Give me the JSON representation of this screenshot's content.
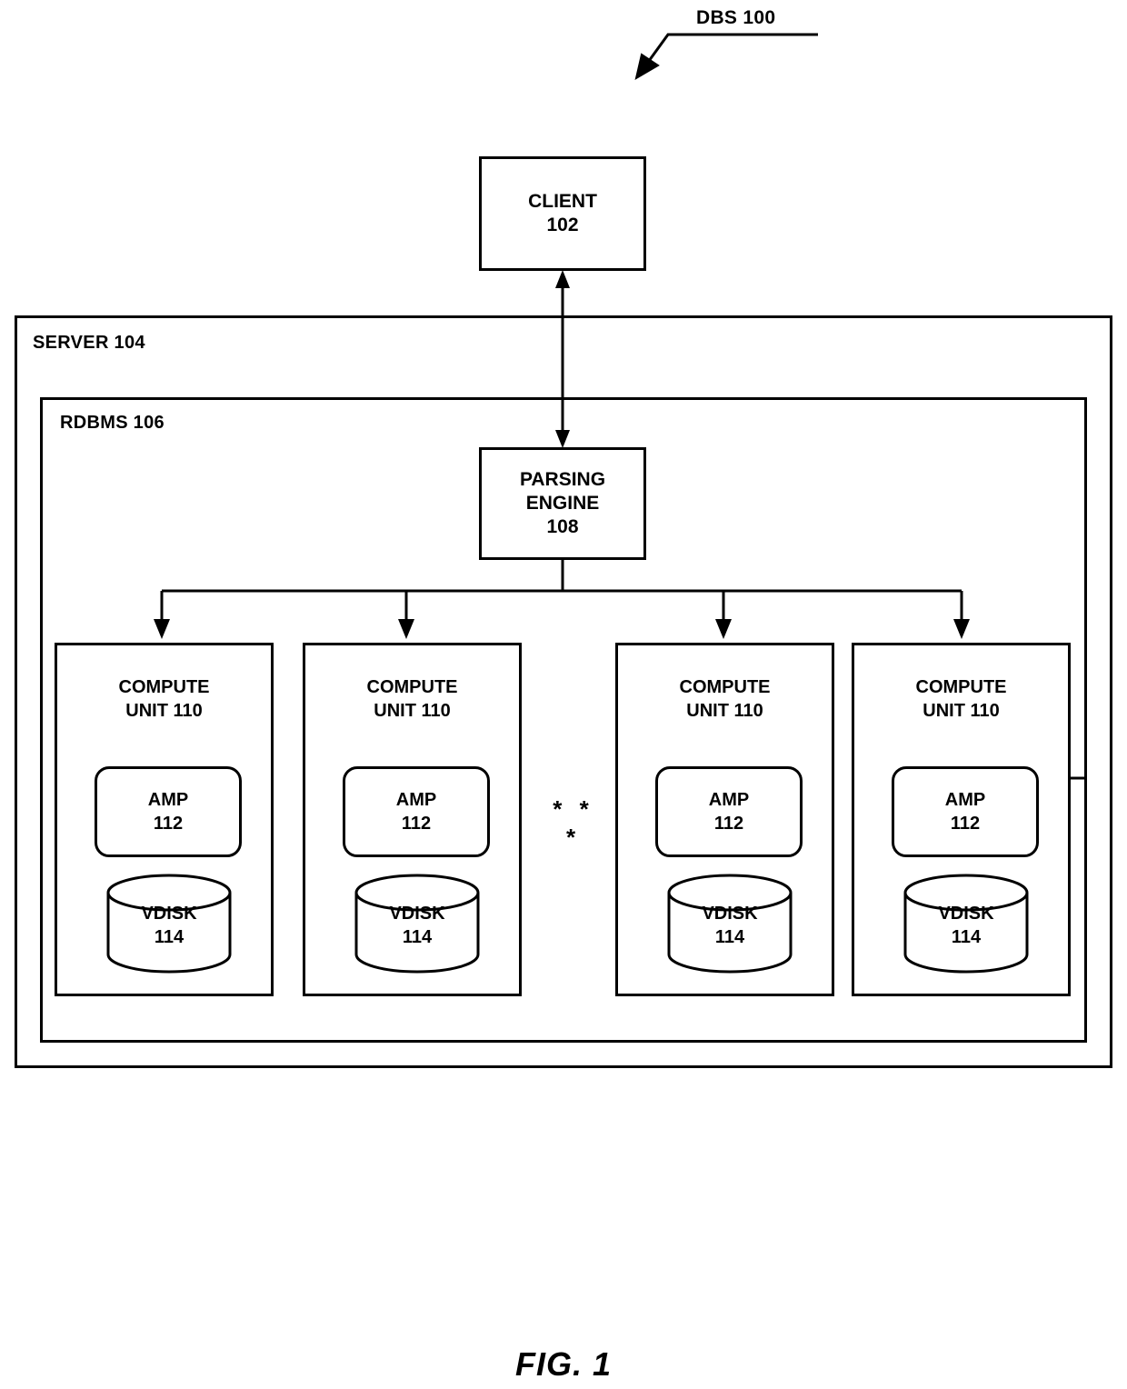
{
  "figure": {
    "caption": "FIG. 1",
    "title_callout": "DBS 100"
  },
  "client": {
    "name": "CLIENT",
    "ref": "102"
  },
  "server": {
    "label": "SERVER 104"
  },
  "rdbms": {
    "label": "RDBMS 106"
  },
  "parsing_engine": {
    "line1": "PARSING",
    "line2": "ENGINE",
    "ref": "108"
  },
  "ellipsis": "* * *",
  "compute_units": [
    {
      "title_line1": "COMPUTE",
      "title_line2": "UNIT 110",
      "amp": {
        "name": "AMP",
        "ref": "112"
      },
      "vdisk": {
        "name": "VDISK",
        "ref": "114"
      }
    },
    {
      "title_line1": "COMPUTE",
      "title_line2": "UNIT 110",
      "amp": {
        "name": "AMP",
        "ref": "112"
      },
      "vdisk": {
        "name": "VDISK",
        "ref": "114"
      }
    },
    {
      "title_line1": "COMPUTE",
      "title_line2": "UNIT 110",
      "amp": {
        "name": "AMP",
        "ref": "112"
      },
      "vdisk": {
        "name": "VDISK",
        "ref": "114"
      }
    },
    {
      "title_line1": "COMPUTE",
      "title_line2": "UNIT 110",
      "amp": {
        "name": "AMP",
        "ref": "112"
      },
      "vdisk": {
        "name": "VDISK",
        "ref": "114"
      }
    }
  ],
  "colors": {
    "stroke": "#000000",
    "background": "#ffffff"
  }
}
